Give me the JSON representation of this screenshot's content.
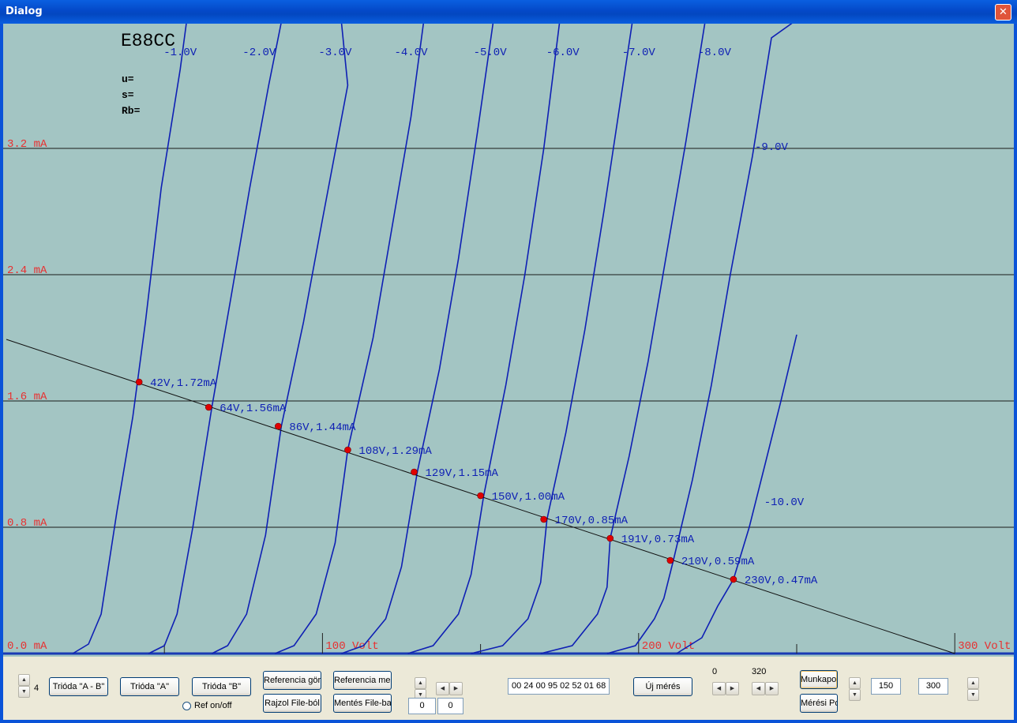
{
  "window": {
    "title": "Dialog",
    "close_glyph": "✕"
  },
  "chart_data": {
    "type": "line",
    "tube_label": "E88CC",
    "params": [
      "u=",
      "s=",
      "Rb="
    ],
    "background_color": "#a3c5c3",
    "curve_color": "#0e1fb4",
    "y_label_color": "#e83030",
    "xlim": [
      0,
      300
    ],
    "ylim": [
      0,
      4
    ],
    "y_grid": [
      {
        "value": 0.0,
        "label": "0.0 mA"
      },
      {
        "value": 0.8,
        "label": "0.8 mA"
      },
      {
        "value": 1.6,
        "label": "1.6 mA"
      },
      {
        "value": 2.4,
        "label": "2.4 mA"
      },
      {
        "value": 3.2,
        "label": "3.2 mA"
      }
    ],
    "x_labels": [
      {
        "value": 100,
        "label": "100 Volt"
      },
      {
        "value": 200,
        "label": "200 Volt"
      },
      {
        "value": 300,
        "label": "300 Volt"
      }
    ],
    "series": [
      {
        "name": "-1.0V",
        "points": [
          [
            21,
            0
          ],
          [
            26,
            0.06
          ],
          [
            30,
            0.25
          ],
          [
            35,
            0.9
          ],
          [
            40,
            1.5
          ],
          [
            44,
            2.1
          ],
          [
            49,
            2.95
          ],
          [
            55,
            3.7
          ],
          [
            57,
            4.0
          ]
        ]
      },
      {
        "name": "-2.0V",
        "points": [
          [
            45,
            0
          ],
          [
            50,
            0.05
          ],
          [
            54,
            0.25
          ],
          [
            59,
            0.8
          ],
          [
            65,
            1.56
          ],
          [
            71,
            2.25
          ],
          [
            77,
            2.95
          ],
          [
            83,
            3.6
          ],
          [
            87,
            4.0
          ]
        ]
      },
      {
        "name": "-3.0V",
        "points": [
          [
            65,
            0
          ],
          [
            70,
            0.05
          ],
          [
            76,
            0.25
          ],
          [
            82,
            0.75
          ],
          [
            87,
            1.44
          ],
          [
            94,
            2.1
          ],
          [
            100,
            2.75
          ],
          [
            108,
            3.6
          ],
          [
            106,
            4.0
          ]
        ]
      },
      {
        "name": "-4.0V",
        "points": [
          [
            85,
            0
          ],
          [
            91,
            0.05
          ],
          [
            98,
            0.25
          ],
          [
            104,
            0.7
          ],
          [
            108,
            1.29
          ],
          [
            116,
            2.0
          ],
          [
            122,
            2.7
          ],
          [
            128,
            3.4
          ],
          [
            132,
            4.0
          ]
        ]
      },
      {
        "name": "-5.0V",
        "points": [
          [
            106,
            0
          ],
          [
            113,
            0.05
          ],
          [
            120,
            0.22
          ],
          [
            125,
            0.55
          ],
          [
            130,
            1.15
          ],
          [
            137,
            1.8
          ],
          [
            143,
            2.5
          ],
          [
            149,
            3.3
          ],
          [
            154,
            4.0
          ]
        ]
      },
      {
        "name": "-6.0V",
        "points": [
          [
            127,
            0
          ],
          [
            135,
            0.05
          ],
          [
            143,
            0.25
          ],
          [
            147,
            0.5
          ],
          [
            151,
            1.0
          ],
          [
            158,
            1.7
          ],
          [
            164,
            2.4
          ],
          [
            170,
            3.2
          ],
          [
            175,
            4.0
          ]
        ]
      },
      {
        "name": "-7.0V",
        "points": [
          [
            147,
            0
          ],
          [
            157,
            0.05
          ],
          [
            165,
            0.22
          ],
          [
            169,
            0.45
          ],
          [
            171,
            0.85
          ],
          [
            177,
            1.4
          ],
          [
            183,
            2.05
          ],
          [
            189,
            2.8
          ],
          [
            195,
            3.6
          ],
          [
            198,
            4.0
          ]
        ]
      },
      {
        "name": "-8.0V",
        "points": [
          [
            169,
            0
          ],
          [
            179,
            0.05
          ],
          [
            187,
            0.25
          ],
          [
            190,
            0.42
          ],
          [
            191,
            0.73
          ],
          [
            197,
            1.25
          ],
          [
            203,
            1.85
          ],
          [
            209,
            2.55
          ],
          [
            215,
            3.25
          ],
          [
            221,
            4.0
          ]
        ]
      },
      {
        "name": "-9.0V",
        "points": [
          [
            190,
            0
          ],
          [
            199,
            0.05
          ],
          [
            205,
            0.22
          ],
          [
            208,
            0.35
          ],
          [
            211,
            0.59
          ],
          [
            217,
            1.1
          ],
          [
            223,
            1.7
          ],
          [
            229,
            2.4
          ],
          [
            236,
            3.15
          ],
          [
            242,
            3.9
          ],
          [
            249,
            4.0
          ]
        ]
      },
      {
        "name": "-10.0V",
        "points": [
          [
            212,
            0
          ],
          [
            220,
            0.1
          ],
          [
            225,
            0.3
          ],
          [
            230,
            0.47
          ],
          [
            235,
            0.8
          ],
          [
            240,
            1.2
          ],
          [
            245,
            1.6
          ],
          [
            250,
            2.02
          ]
        ]
      }
    ],
    "curve_labels": [
      {
        "text": "-1.0V",
        "x": 55,
        "y": 3.79
      },
      {
        "text": "-2.0V",
        "x": 80,
        "y": 3.79
      },
      {
        "text": "-3.0V",
        "x": 104,
        "y": 3.79
      },
      {
        "text": "-4.0V",
        "x": 128,
        "y": 3.79
      },
      {
        "text": "-5.0V",
        "x": 153,
        "y": 3.79
      },
      {
        "text": "-6.0V",
        "x": 176,
        "y": 3.79
      },
      {
        "text": "-7.0V",
        "x": 200,
        "y": 3.79
      },
      {
        "text": "-8.0V",
        "x": 224,
        "y": 3.79
      },
      {
        "text": "-9.0V",
        "x": 242,
        "y": 3.19
      },
      {
        "text": "-10.0V",
        "x": 246,
        "y": 0.94
      }
    ],
    "load_line": {
      "points": [
        [
          0,
          1.99
        ],
        [
          300,
          0
        ]
      ]
    },
    "operating_points": [
      {
        "x": 42,
        "y": 1.72,
        "label": "42V,1.72mA"
      },
      {
        "x": 64,
        "y": 1.56,
        "label": "64V,1.56mA"
      },
      {
        "x": 86,
        "y": 1.44,
        "label": "86V,1.44mA"
      },
      {
        "x": 108,
        "y": 1.29,
        "label": "108V,1.29mA"
      },
      {
        "x": 129,
        "y": 1.15,
        "label": "129V,1.15mA"
      },
      {
        "x": 150,
        "y": 1.0,
        "label": "150V,1.00mA"
      },
      {
        "x": 170,
        "y": 0.85,
        "label": "170V,0.85mA"
      },
      {
        "x": 191,
        "y": 0.73,
        "label": "191V,0.73mA"
      },
      {
        "x": 210,
        "y": 0.59,
        "label": "210V,0.59mA"
      },
      {
        "x": 230,
        "y": 0.47,
        "label": "230V,0.47mA"
      }
    ]
  },
  "controls": {
    "spin_value": "4",
    "btn_trioda_ab": "Trióda \"A - B\"",
    "btn_trioda_a": "Trióda  \"A\"",
    "btn_trioda_b": "Trióda  \"B\"",
    "ref_toggle": "Ref on/off",
    "btn_ref_curve": "Referencia görbe",
    "btn_ref_save": "Referencia mentés",
    "btn_draw_file": "Rajzol File-ból",
    "btn_save_file": "Mentés File-ba",
    "field_a": "0",
    "field_b": "0",
    "hex_field": "00 24 00 95 02 52 01 68",
    "btn_new_measure": "Új mérés",
    "range_low": "0",
    "range_high": "320",
    "btn_operating_point": "Munkapont",
    "btn_measure_point": "Mérési Pont",
    "field_150": "150",
    "field_300": "300"
  }
}
